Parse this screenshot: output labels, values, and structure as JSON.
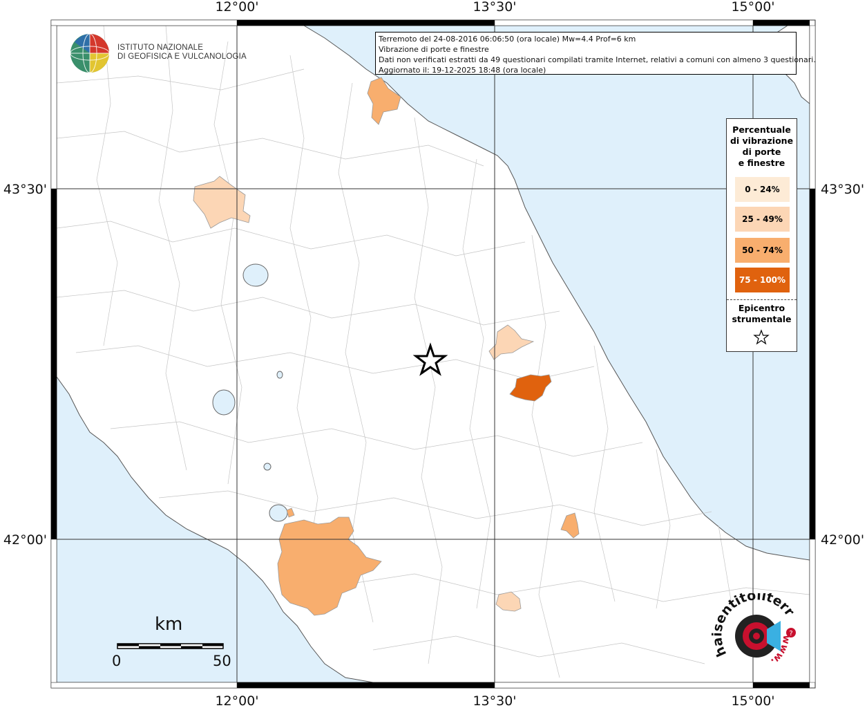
{
  "map": {
    "longitude_labels": [
      "12°00'",
      "13°30'",
      "15°00'"
    ],
    "latitude_labels": [
      "43°30'",
      "42°00'"
    ],
    "colors": {
      "sea": "#dff0fb",
      "land": "#ffffff",
      "boundary": "#b8b8b8",
      "class_0_24": "#fdebd6",
      "class_25_49": "#fcd6b5",
      "class_50_74": "#f8ae6e",
      "class_75_100": "#e0620e"
    }
  },
  "info": {
    "line1": "Terremoto del 24-08-2016 06:06:50 (ora locale) Mw=4.4 Prof=6 km",
    "line2": "Vibrazione di porte e finestre",
    "line3": "Dati non verificati estratti da 49 questionari compilati tramite Internet, relativi a comuni con almeno 3 questionari.",
    "line4": "Aggiornato il: 19-12-2025 18:48 (ora locale)"
  },
  "legend": {
    "title_lines": [
      "Percentuale",
      "di vibrazione",
      "di porte",
      "e finestre"
    ],
    "classes": [
      {
        "label": "0 - 24%",
        "color": "#fdebd6",
        "text_color": "#000000"
      },
      {
        "label": "25 - 49%",
        "color": "#fcd6b5",
        "text_color": "#000000"
      },
      {
        "label": "50 - 74%",
        "color": "#f8ae6e",
        "text_color": "#000000"
      },
      {
        "label": "75 - 100%",
        "color": "#e0620e",
        "text_color": "#ffffff"
      }
    ],
    "epicenter_lines": [
      "Epicentro",
      "strumentale"
    ],
    "epicenter_icon": "star-outline-icon"
  },
  "logo": {
    "line1": "ISTITUTO NAZIONALE",
    "line2": "DI GEOFISICA E VULCANOLOGIA"
  },
  "scale_bar": {
    "unit": "km",
    "min_label": "0",
    "max_label": "50"
  },
  "haisentito": {
    "text_top": "haisentitoilterremoto.it",
    "text_bottom": "www.",
    "icon": "haisentito-logo-icon"
  }
}
